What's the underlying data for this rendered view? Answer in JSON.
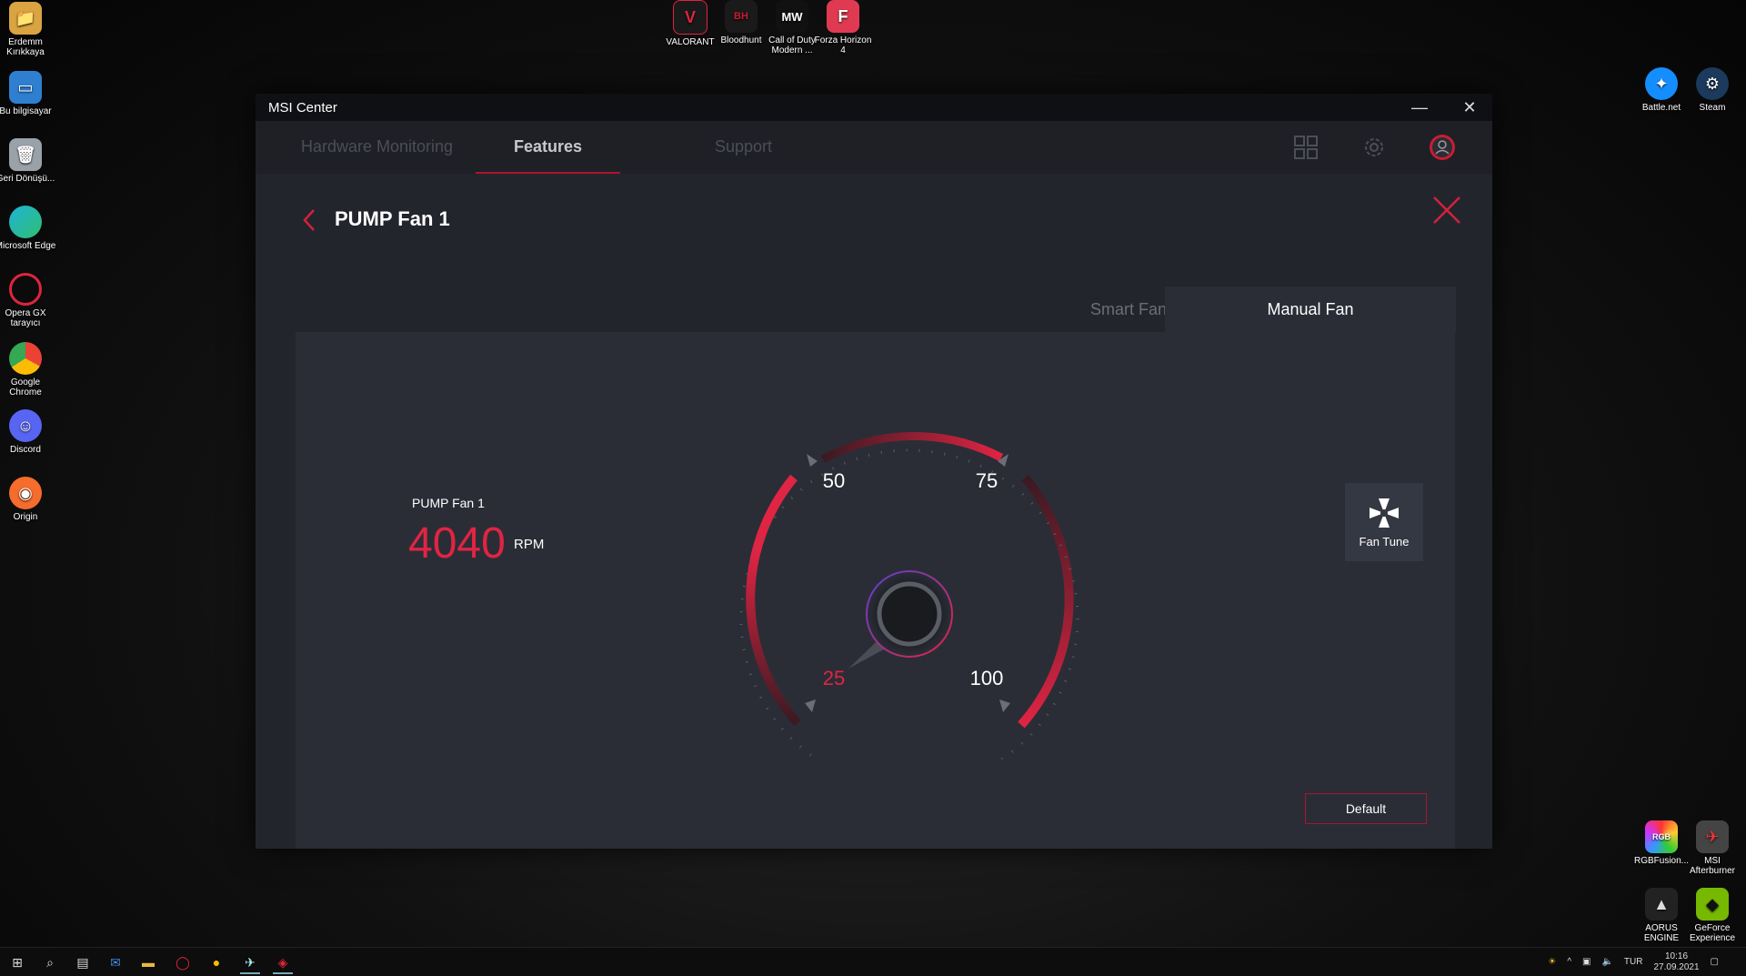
{
  "desktop": {
    "left_icons": [
      {
        "label": "Erdemm Kırıkkaya",
        "icon": "folder-user-icon"
      },
      {
        "label": "Bu bilgisayar",
        "icon": "computer-icon"
      },
      {
        "label": "Geri Dönüşü...",
        "icon": "recycle-bin-icon"
      },
      {
        "label": "Microsoft Edge",
        "icon": "edge-icon"
      },
      {
        "label": "Opera GX tarayıcı",
        "icon": "opera-gx-icon"
      },
      {
        "label": "Google Chrome",
        "icon": "chrome-icon"
      },
      {
        "label": "Discord",
        "icon": "discord-icon"
      },
      {
        "label": "Origin",
        "icon": "origin-icon"
      }
    ],
    "top_icons": [
      {
        "label": "VALORANT",
        "icon": "valorant-icon"
      },
      {
        "label": "Bloodhunt",
        "icon": "bloodhunt-icon"
      },
      {
        "label": "Call of Duty Modern ...",
        "icon": "cod-icon"
      },
      {
        "label": "Forza Horizon 4",
        "icon": "forza-icon"
      }
    ],
    "right_icons": [
      {
        "label": "Battle.net",
        "icon": "battlenet-icon"
      },
      {
        "label": "Steam",
        "icon": "steam-icon"
      },
      {
        "label": "RGBFusion...",
        "icon": "rgbfusion-icon"
      },
      {
        "label": "MSI Afterburner",
        "icon": "afterburner-icon"
      },
      {
        "label": "AORUS ENGINE",
        "icon": "aorus-icon"
      },
      {
        "label": "GeForce Experience",
        "icon": "geforce-icon"
      }
    ]
  },
  "window": {
    "title": "MSI Center",
    "tabs": [
      {
        "label": "Hardware Monitoring",
        "active": false
      },
      {
        "label": "Features",
        "active": true
      },
      {
        "label": "Support",
        "active": false
      }
    ]
  },
  "page": {
    "title": "PUMP Fan 1",
    "modes": [
      {
        "label": "Smart Fan",
        "active": false
      },
      {
        "label": "Manual Fan",
        "active": true
      }
    ],
    "fan_name": "PUMP Fan 1",
    "rpm_value": "4040",
    "rpm_unit": "RPM",
    "gauge": {
      "ticks": [
        "25",
        "50",
        "75",
        "100"
      ],
      "needle_value_percent": 25
    },
    "fan_tune_label": "Fan Tune",
    "default_label": "Default"
  },
  "taskbar": {
    "lang": "TUR",
    "time": "10:16",
    "date": "27.09.2021"
  },
  "colors": {
    "accent": "#e02443",
    "panel": "#2a2d36"
  }
}
